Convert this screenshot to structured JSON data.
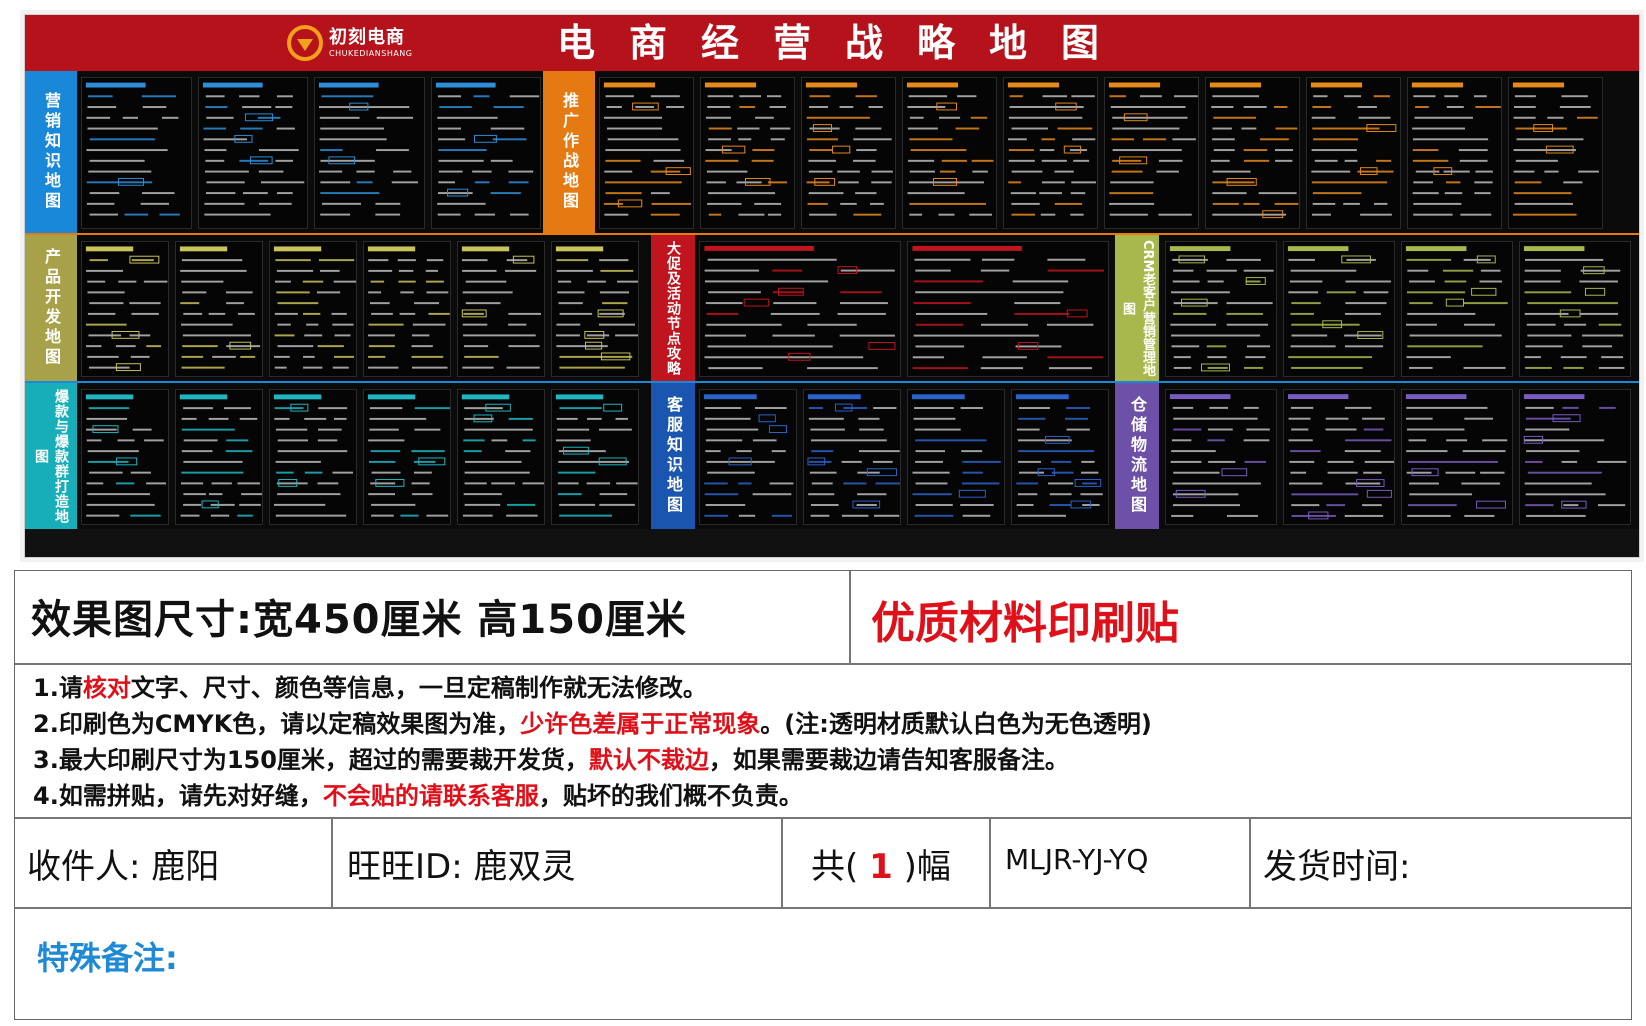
{
  "poster": {
    "brand_cn": "初刻电商",
    "brand_en": "CHUKEDIANSHANG",
    "title": "电商经营战略地图",
    "sections": [
      {
        "label": "营销知识地图",
        "color": "#1a88d8"
      },
      {
        "label": "推广作战地图",
        "color": "#e57a12"
      },
      {
        "label": "产品开发地图",
        "color": "#a7a24a"
      },
      {
        "label": "大促及活动节点攻略",
        "color": "#c0141e"
      },
      {
        "label": "CRM老客户营销管理地图",
        "color": "#a9b84d"
      },
      {
        "label": "爆款与爆款群打造地图",
        "color": "#18aeb9"
      },
      {
        "label": "客服知识地图",
        "color": "#1a55b0"
      },
      {
        "label": "仓储物流地图",
        "color": "#6d51a8"
      }
    ]
  },
  "info": {
    "size_text": "效果图尺寸:宽450厘米 高150厘米",
    "material_text": "优质材料印刷贴",
    "notes": {
      "n1_a": "1.请",
      "n1_b": "核对",
      "n1_c": "文字、尺寸、颜色等信息，一旦定稿制作就无法修改。",
      "n2_a": "2.印刷色为CMYK色，请以定稿效果图为准，",
      "n2_b": "少许色差属于正常现象",
      "n2_c": "。(注:透明材质默认白色为无色透明)",
      "n3_a": "3.最大印刷尺寸为150厘米，超过的需要裁开发货，",
      "n3_b": "默认不裁边",
      "n3_c": "，如果需要裁边请告知客服备注。",
      "n4_a": "4.如需拼贴，请先对好缝，",
      "n4_b": "不会贴的请联系客服",
      "n4_c": "，贴坏的我们概不负责。"
    },
    "recipient": "收件人:  鹿阳",
    "wangwang": "旺旺ID:  鹿双灵",
    "count_prefix": "共(",
    "count_value": "1",
    "count_suffix": ")幅",
    "code": "MLJR-YJ-YQ",
    "ship_time": "发货时间:",
    "special_note": "特殊备注:"
  }
}
